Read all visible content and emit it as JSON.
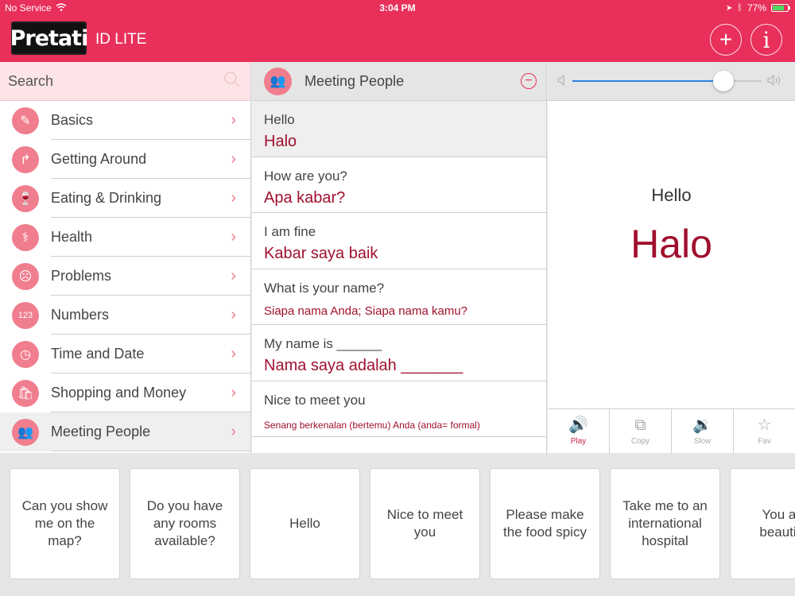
{
  "status": {
    "carrier": "No Service",
    "time": "3:04 PM",
    "battery": "77%",
    "battery_level": 0.77
  },
  "header": {
    "logo": "Pretati",
    "subtitle": "ID LITE",
    "add_label": "+",
    "info_label": "i"
  },
  "search": {
    "placeholder": "Search"
  },
  "categories": [
    {
      "label": "Basics",
      "icon": "pencil-icon",
      "glyph": "✎"
    },
    {
      "label": "Getting Around",
      "icon": "turn-arrow-icon",
      "glyph": "↱"
    },
    {
      "label": "Eating & Drinking",
      "icon": "glass-icon",
      "glyph": "🍷"
    },
    {
      "label": "Health",
      "icon": "stethoscope-icon",
      "glyph": "⚕"
    },
    {
      "label": "Problems",
      "icon": "sad-face-icon",
      "glyph": "☹"
    },
    {
      "label": "Numbers",
      "icon": "numbers-icon",
      "glyph": "123"
    },
    {
      "label": "Time and Date",
      "icon": "clock-icon",
      "glyph": "◷"
    },
    {
      "label": "Shopping and Money",
      "icon": "shopping-bag-icon",
      "glyph": "🛍"
    },
    {
      "label": "Meeting People",
      "icon": "people-icon",
      "glyph": "👥"
    }
  ],
  "selected_category": "Meeting People",
  "phrase_panel": {
    "title": "Meeting People",
    "icon": "people-icon",
    "glyph": "👥",
    "collapse": "−"
  },
  "phrases": [
    {
      "en": "Hello",
      "id": "Halo"
    },
    {
      "en": "How are you?",
      "id": "Apa kabar?"
    },
    {
      "en": "I am fine",
      "id": "Kabar saya baik"
    },
    {
      "en": "What is your name?",
      "id": "Siapa nama Anda; Siapa nama kamu?"
    },
    {
      "en": "My name is ______",
      "id": "Nama saya adalah _______"
    },
    {
      "en": "Nice to meet you",
      "id": "Senang berkenalan (bertemu) Anda (anda= formal)"
    }
  ],
  "volume": {
    "level": 0.8
  },
  "display": {
    "en": "Hello",
    "id": "Halo"
  },
  "actions": [
    {
      "label": "Play",
      "icon": "speaker-icon",
      "glyph": "🔊"
    },
    {
      "label": "Copy",
      "icon": "copy-icon",
      "glyph": "⧉"
    },
    {
      "label": "Slow",
      "icon": "slow-speaker-icon",
      "glyph": "🔉"
    },
    {
      "label": "Fav",
      "icon": "star-icon",
      "glyph": "☆"
    }
  ],
  "favorites": [
    "Can you show me on the map?",
    "Do you have any rooms available?",
    "Hello",
    "Nice to meet you",
    "Please make the food spicy",
    "Take me to an international hospital",
    "You are beautiful"
  ],
  "colors": {
    "brand": "#e8305a",
    "accent_text": "#a0102e",
    "icon_bg": "#f07e8e",
    "search_bg": "#fde4e6"
  }
}
